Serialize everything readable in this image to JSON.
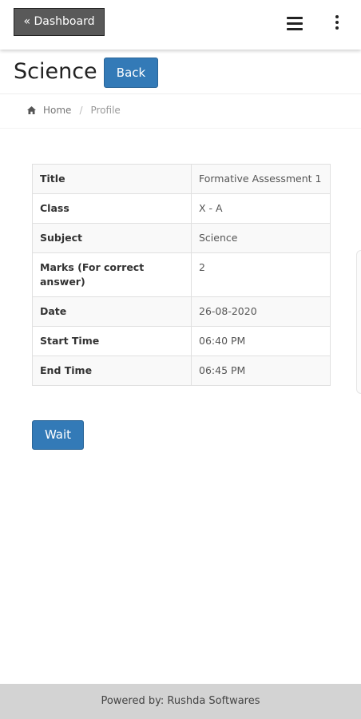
{
  "topbar": {
    "dashboard_label": "« Dashboard",
    "menu_icon": "hamburger-menu-icon",
    "overflow_icon": "vertical-ellipsis-icon"
  },
  "header": {
    "title": "Science",
    "back_label": "Back"
  },
  "breadcrumb": {
    "home_icon": "home-icon",
    "items": [
      "Home",
      "Profile"
    ],
    "separator": "/"
  },
  "details": {
    "rows": [
      {
        "label": "Title",
        "value": "Formative Assessment 1"
      },
      {
        "label": "Class",
        "value": "X - A"
      },
      {
        "label": "Subject",
        "value": "Science"
      },
      {
        "label": "Marks (For correct answer)",
        "value": "2"
      },
      {
        "label": "Date",
        "value": "26-08-2020"
      },
      {
        "label": "Start Time",
        "value": "06:40 PM"
      },
      {
        "label": "End Time",
        "value": "06:45 PM"
      }
    ]
  },
  "actions": {
    "wait_label": "Wait"
  },
  "footer": {
    "text": "Powered by: Rushda Softwares"
  },
  "colors": {
    "primary": "#337ab7",
    "dashboard_bg": "#595959",
    "footer_bg": "#d3d3d3"
  }
}
